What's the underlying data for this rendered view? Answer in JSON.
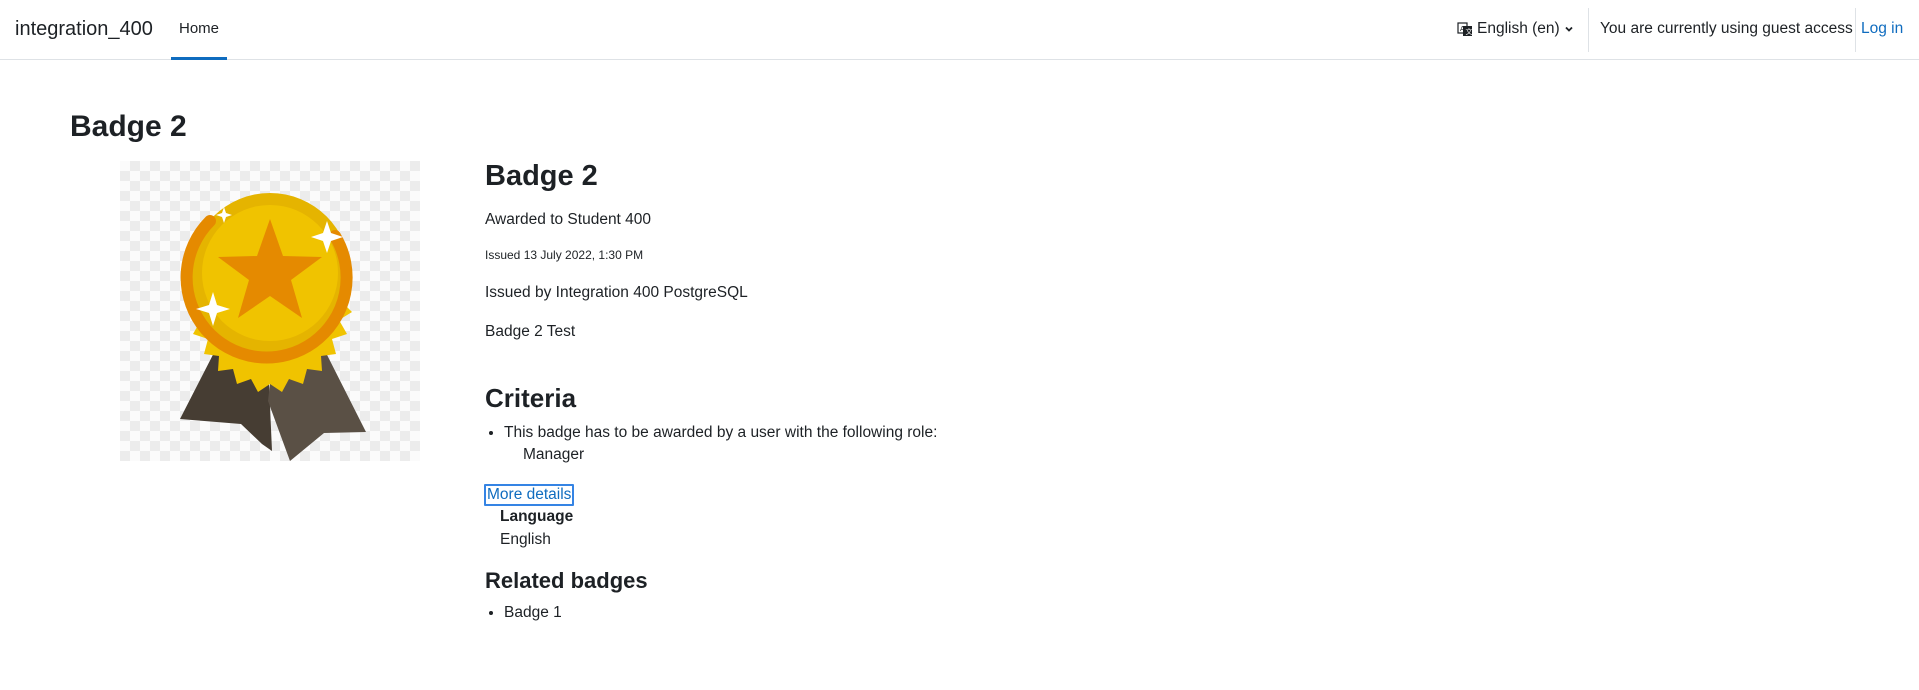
{
  "navbar": {
    "site_name": "integration_400",
    "home_label": "Home",
    "language_label": "English (en)",
    "guest_text": "You are currently using guest access",
    "login_label": "Log in",
    "accent_color": "#0f6cbf"
  },
  "page": {
    "title": "Badge 2"
  },
  "badge": {
    "image_icon": "award-rosette-icon",
    "name": "Badge 2",
    "awarded_to": "Awarded to Student 400",
    "issued": "Issued 13 July 2022, 1:30 PM",
    "issuer": "Issued by Integration 400 PostgreSQL",
    "description": "Badge 2 Test"
  },
  "criteria": {
    "heading": "Criteria",
    "item": "This badge has to be awarded by a user with the following role:",
    "role": "Manager"
  },
  "more_details": {
    "link_label": "More details",
    "language_label": "Language",
    "language_value": "English"
  },
  "related": {
    "heading": "Related badges",
    "items": [
      "Badge 1"
    ]
  }
}
